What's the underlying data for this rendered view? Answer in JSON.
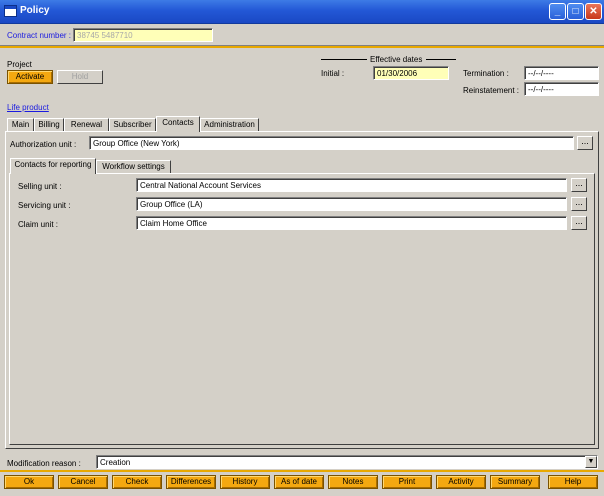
{
  "window": {
    "title": "Policy"
  },
  "contract": {
    "label": "Contract number :",
    "value": "38745 5487710"
  },
  "project": {
    "label": "Project",
    "activate_label": "Activate",
    "hold_label": "Hold"
  },
  "effective_dates": {
    "heading": "Effective dates",
    "initial_label": "Initial :",
    "initial_value": "01/30/2006",
    "termination_label": "Termination :",
    "termination_value": "--/--/----",
    "reinstatement_label": "Reinstatement :",
    "reinstatement_value": "--/--/----"
  },
  "product_link": "Life product",
  "tabs": [
    "Main",
    "Billing",
    "Renewal",
    "Subscriber",
    "Contacts",
    "Administration"
  ],
  "active_tab": "Contacts",
  "authorization": {
    "label": "Authorization unit :",
    "value": "Group Office (New York)"
  },
  "subtabs": [
    "Contacts for reporting",
    "Workflow settings"
  ],
  "units": {
    "selling_label": "Selling unit :",
    "selling_value": "Central National Account Services",
    "servicing_label": "Servicing unit :",
    "servicing_value": "Group Office (LA)",
    "claim_label": "Claim unit :",
    "claim_value": "Claim Home Office"
  },
  "modification": {
    "label": "Modification reason :",
    "value": "Creation"
  },
  "bottom_buttons": [
    "Ok",
    "Cancel",
    "Check",
    "Differences",
    "History",
    "As of date",
    "Notes",
    "Print",
    "Activity",
    "Summary",
    "Help"
  ],
  "ellipsis": "...",
  "window_controls": {
    "minimize": "_",
    "maximize": "□",
    "close": "✕"
  },
  "colors": {
    "title_bar": "#2358d6",
    "accent_gold": "#f4a810",
    "field_yellow": "#ffffb8",
    "link_blue": "#1a1ae0"
  }
}
